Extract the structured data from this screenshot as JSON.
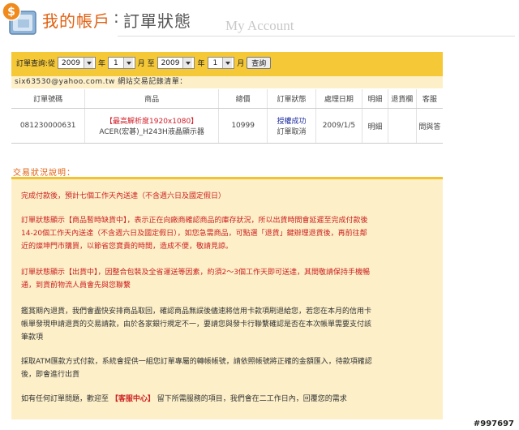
{
  "header": {
    "title_main": "我的帳戶",
    "colon": ":",
    "title_sub": "訂單狀態",
    "title_en": "My Account"
  },
  "query": {
    "label": "訂單查詢:從",
    "from_year": "2009",
    "year_unit_1": "年",
    "from_month": "1",
    "month_unit_1": "月 至",
    "to_year": "2009",
    "year_unit_2": "年",
    "to_month": "1",
    "month_unit_2": "月",
    "search_button": "查詢"
  },
  "account_line": "six63530@yahoo.com.tw 網站交易記錄清單：",
  "table": {
    "headers": [
      "訂單號碼",
      "商品",
      "總價",
      "訂單狀態",
      "處理日期",
      "明細",
      "退貨欄",
      "客服"
    ],
    "rows": [
      {
        "order_no": "081230000631",
        "product_tag": "【最高解析度1920x1080】",
        "product_name": "ACER(宏碁)_H243H液晶顯示器",
        "total": "10999",
        "status_1": "授權成功",
        "status_2": "訂單取消",
        "date": "2009/1/5",
        "detail": "明細",
        "return": "",
        "service": "問與答"
      }
    ]
  },
  "notes": {
    "title": "交易狀況說明：",
    "n1": "完成付款後，預計七個工作天內送達（不含週六日及國定假日）",
    "n2a": "訂單狀態顯示【商品暫時缺貨中】，表示正在向廠商確認商品的庫存狀況，所以出貨時間會延遲至完成付款後",
    "n2b": "14-20個工作天內送達（不含週六日及國定假日），如您急需商品，可點選「退貨」鍵辦理退貨後，再前往鄰",
    "n2c": "近的燦坤門市購買，以節省您寶貴的時間，造成不便，敬請見諒。",
    "n3a": "訂單狀態顯示【出貨中】，因整合包裝及全省運送等因素，約須2～3個工作天即可送達，其間敬請保持手機暢",
    "n3b": "通，到貨前物流人員會先與您聯繫",
    "n4a": "鑑賞期內退貨，我們會盡快安排商品取回，確認商品無誤後儘速將信用卡款項刷退給您，若您在本月的信用卡",
    "n4b": "帳單發現申請退貨的交易請款，由於各家銀行規定不一，要請您與發卡行聯繫確認是否在本次帳單需要支付該",
    "n4c": "筆款項",
    "n5a": "採取ATM匯款方式付款，系統會提供一組您訂單專屬的轉帳帳號，請依照帳號將正確的金額匯入，待款項確認",
    "n5b": "後，即會進行出貨",
    "n6_pre": "如有任何訂單問題，歡迎至",
    "n6_link": "【客服中心】",
    "n6_post": "留下所需服務的項目，我們會在二工作日內，回覆您的需求"
  },
  "watermark": "#997697"
}
